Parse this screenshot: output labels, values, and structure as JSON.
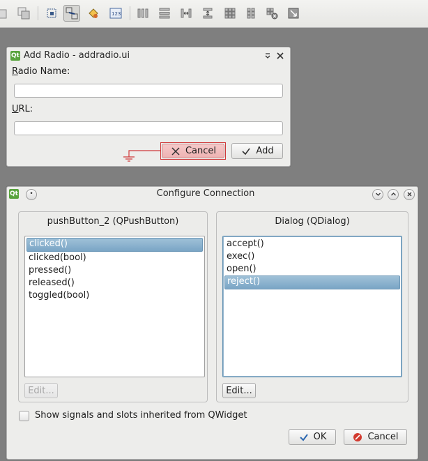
{
  "toolbar": {
    "icons": [
      "bring-to-front-icon",
      "send-to-back-icon",
      "edit-widgets-icon",
      "edit-signals-slots-icon",
      "edit-buddies-icon",
      "edit-tab-order-icon",
      "layout-horizontal-icon",
      "layout-vertical-icon",
      "layout-horizontal-splitter-icon",
      "layout-vertical-splitter-icon",
      "layout-grid-icon",
      "layout-form-icon",
      "break-layout-icon",
      "adjust-size-icon"
    ]
  },
  "add_radio": {
    "title": "Add Radio - addradio.ui",
    "radio_name_label_accel": "R",
    "radio_name_label_rest": "adio Name:",
    "radio_name_value": "",
    "url_label_accel": "U",
    "url_label_rest": "RL:",
    "url_value": "",
    "cancel_label": "Cancel",
    "add_label": "Add",
    "accent_color": "#d03a3a"
  },
  "configure": {
    "title": "Configure Connection",
    "left_title": "pushButton_2 (QPushButton)",
    "right_title": "Dialog (QDialog)",
    "signals": [
      {
        "label": "clicked()",
        "selected": true
      },
      {
        "label": "clicked(bool)",
        "selected": false
      },
      {
        "label": "pressed()",
        "selected": false
      },
      {
        "label": "released()",
        "selected": false
      },
      {
        "label": "toggled(bool)",
        "selected": false
      }
    ],
    "slots": [
      {
        "label": "accept()",
        "selected": false
      },
      {
        "label": "exec()",
        "selected": false
      },
      {
        "label": "open()",
        "selected": false
      },
      {
        "label": "reject()",
        "selected": true
      }
    ],
    "left_edit_label": "Edit...",
    "right_edit_label": "Edit...",
    "show_inherited_label": "Show signals and slots inherited from QWidget",
    "show_inherited_checked": false,
    "ok_label": "OK",
    "cancel_label": "Cancel",
    "selection_color": "#7aa5c5"
  }
}
